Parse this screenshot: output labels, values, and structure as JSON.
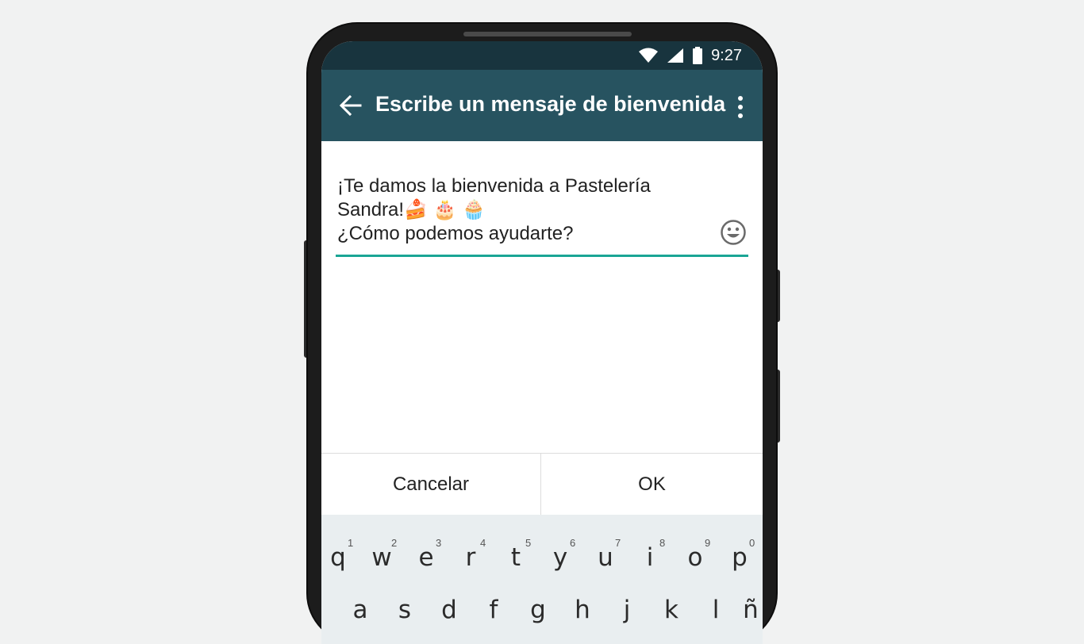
{
  "status_bar": {
    "time": "9:27",
    "icons": [
      "wifi-icon",
      "signal-icon",
      "battery-icon"
    ]
  },
  "app_bar": {
    "title": "Escribe un mensaje de bienvenida",
    "back_icon": "arrow-left-icon",
    "menu_icon": "more-vert-icon"
  },
  "message": {
    "line1": "¡Te damos la bienvenida a Pastelería",
    "line2": "Sandra!",
    "line2_emojis": [
      "🍰",
      "🎂",
      "🧁"
    ],
    "line3": "¿Cómo podemos ayudarte?",
    "emoji_button_icon": "smiley-icon"
  },
  "dialog": {
    "cancel_label": "Cancelar",
    "ok_label": "OK"
  },
  "keyboard": {
    "row1": [
      {
        "letter": "q",
        "hint": "1"
      },
      {
        "letter": "w",
        "hint": "2"
      },
      {
        "letter": "e",
        "hint": "3"
      },
      {
        "letter": "r",
        "hint": "4"
      },
      {
        "letter": "t",
        "hint": "5"
      },
      {
        "letter": "y",
        "hint": "6"
      },
      {
        "letter": "u",
        "hint": "7"
      },
      {
        "letter": "i",
        "hint": "8"
      },
      {
        "letter": "o",
        "hint": "9"
      },
      {
        "letter": "p",
        "hint": "0"
      }
    ],
    "row2": [
      "a",
      "s",
      "d",
      "f",
      "g",
      "h",
      "j",
      "k",
      "l",
      "ñ"
    ]
  },
  "colors": {
    "status_bar": "#18343e",
    "app_bar": "#275360",
    "accent": "#1aa595",
    "keyboard_bg": "#e9eef0"
  }
}
